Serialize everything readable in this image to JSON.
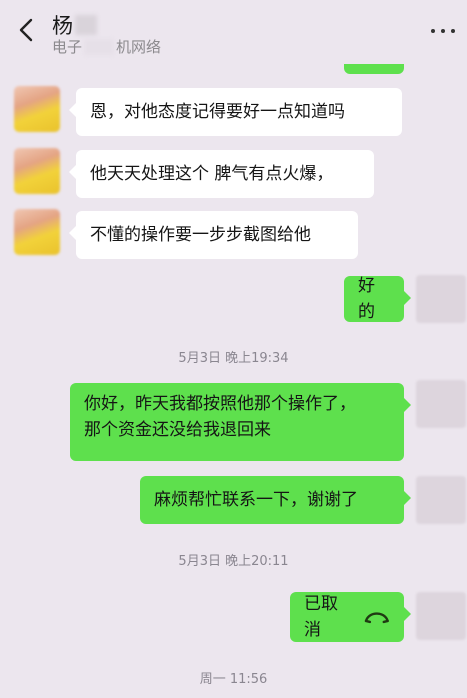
{
  "header": {
    "contact_name": "杨",
    "contact_org_prefix": "电子",
    "contact_org_suffix": "机网络"
  },
  "messages": [
    {
      "side": "in",
      "text": "恩，对他态度记得要好一点知道吗"
    },
    {
      "side": "in",
      "text": "他天天处理这个 脾气有点火爆，"
    },
    {
      "side": "in",
      "text": "不懂的操作要一步步截图给他"
    },
    {
      "side": "out",
      "text": "好的"
    },
    {
      "side": "out",
      "line1": "你好，昨天我都按照他那个操作了，",
      "line2": "那个资金还没给我退回来"
    },
    {
      "side": "out",
      "text": "麻烦帮忙联系一下，谢谢了"
    },
    {
      "side": "out",
      "text": "已取消",
      "icon": "cancelled-call-icon"
    }
  ],
  "timestamps": [
    "5月3日 晚上19:34",
    "5月3日 晚上20:11",
    "周一 11:56"
  ],
  "colors": {
    "sent_bubble": "#5ee04d",
    "received_bubble": "#ffffff",
    "background": "#ece6ee"
  }
}
